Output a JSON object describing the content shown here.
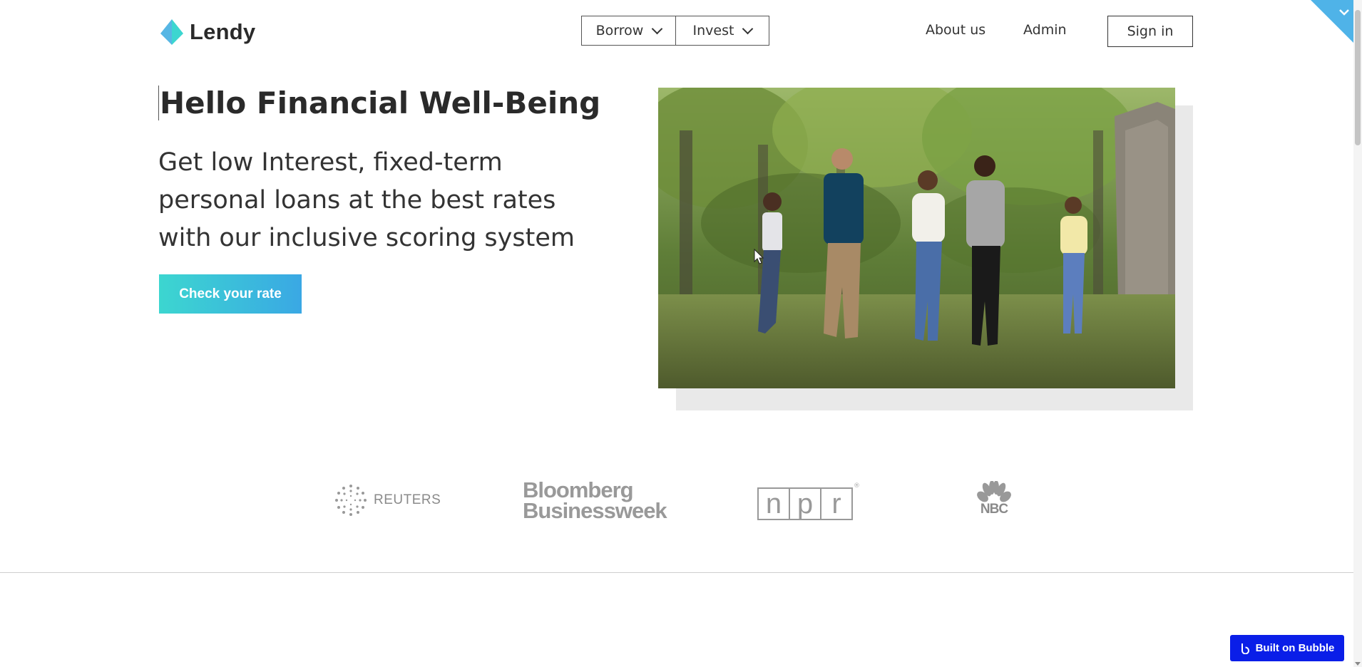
{
  "brand": {
    "name": "Lendy",
    "accent": "#3cc3dc"
  },
  "nav": {
    "borrow_label": "Borrow",
    "invest_label": "Invest",
    "about_label": "About us",
    "admin_label": "Admin",
    "signin_label": "Sign in"
  },
  "hero": {
    "title": "Hello Financial Well-Being",
    "subtitle": "Get low Interest, fixed-term personal loans at the best rates with our inclusive scoring system",
    "cta_label": "Check your rate",
    "cta_gradient": [
      "#3cd6d0",
      "#3aa8e4"
    ]
  },
  "press": {
    "reuters": "REUTERS",
    "bloomberg_line1": "Bloomberg",
    "bloomberg_line2": "Businessweek",
    "npr_letters": [
      "n",
      "p",
      "r"
    ],
    "npr_reg": "®",
    "nbc": "NBC"
  },
  "badge": {
    "label": "Built on Bubble",
    "color": "#0a1ee8"
  },
  "icons": {
    "logo": "lendy-logo-icon",
    "borrow_caret": "chevron-down-icon",
    "invest_caret": "chevron-down-icon",
    "corner": "chevron-down-icon",
    "bubble": "bubble-logo-icon"
  }
}
